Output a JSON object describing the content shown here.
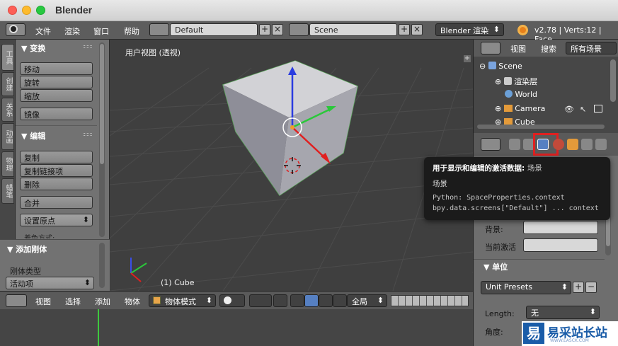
{
  "window": {
    "title": "Blender"
  },
  "infobar": {
    "menus": [
      "文件",
      "渲染",
      "窗口",
      "帮助"
    ],
    "screen_layout": "Default",
    "scene": "Scene",
    "engine": "Blender 渲染",
    "status": "v2.78 | Verts:12 | Face"
  },
  "tool_tabs": [
    "工具",
    "创建",
    "关系",
    "动画",
    "物理",
    "蜡笔"
  ],
  "transform": {
    "header": "▼ 变换",
    "buttons": [
      "移动",
      "旋转",
      "缩放"
    ],
    "mirror": "镜像"
  },
  "edit": {
    "header": "▼ 编辑",
    "buttons": [
      "复制",
      "复制链接项",
      "删除"
    ],
    "join": "合并",
    "set_origin": "设置原点",
    "shading_partial": "着色方式:"
  },
  "rigid": {
    "header": "▼ 添加刚体",
    "type_label": "刚体类型",
    "type_value": "活动项"
  },
  "viewport": {
    "title": "用户视图 (透视)",
    "object_label": "(1) Cube"
  },
  "view_header": {
    "menus": [
      "视图",
      "选择",
      "添加",
      "物体"
    ],
    "mode": "物体模式",
    "orientation": "全局"
  },
  "outliner": {
    "view": "视图",
    "search": "搜索",
    "filter": "所有场景",
    "items": [
      "Scene",
      "渲染层",
      "World",
      "Camera",
      "Cube"
    ]
  },
  "properties": {
    "world_label": "背景:",
    "active_label": "当前激活",
    "units_header": "▼ 单位",
    "unit_presets": "Unit Presets",
    "length_label": "Length:",
    "length_value": "无",
    "angle_label": "角度:"
  },
  "tooltip": {
    "title": "用于显示和编辑的激活数据:",
    "title_value": "场景",
    "desc": "场景",
    "python": "Python: SpaceProperties.context",
    "bpy": "bpy.data.screens[\"Default\"] ... context"
  },
  "watermark": {
    "text": "易采站长站",
    "sub": "WWW.EASCK.COM"
  },
  "colors": {
    "highlight": "#e02020",
    "accent": "#5680c2"
  }
}
